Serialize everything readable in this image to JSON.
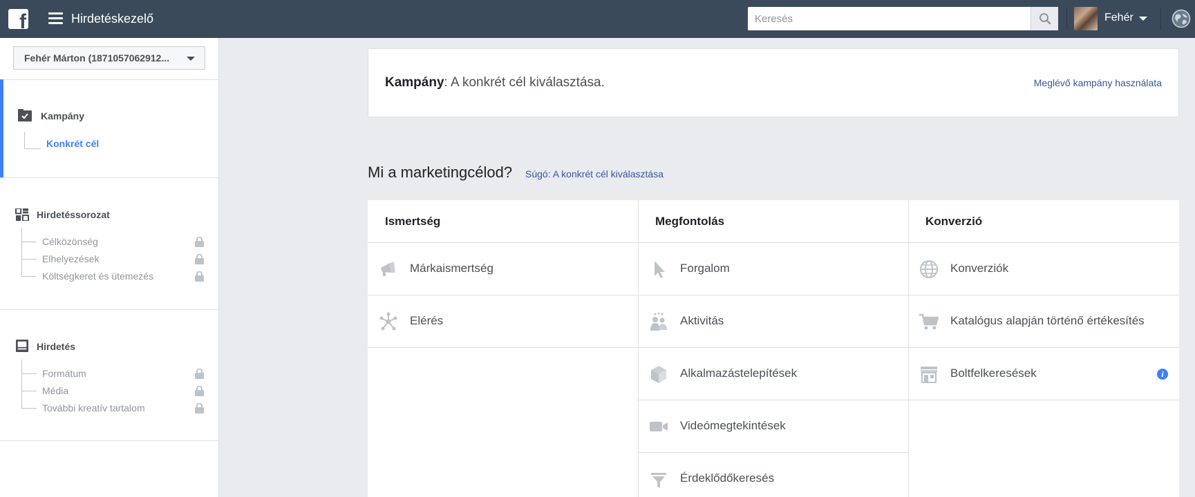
{
  "topbar": {
    "app_title": "Hirdetéskezelő",
    "search_placeholder": "Keresés",
    "user_name": "Fehér",
    "logo_letter": "f",
    "icons": [
      "facebook-logo-icon",
      "hamburger-menu-icon",
      "search-icon",
      "chevron-down-icon",
      "globe-icon"
    ]
  },
  "sidebar": {
    "account_label": "Fehér Márton (1871057062912...",
    "campaign": {
      "title": "Kampány",
      "active_item": "Konkrét cél"
    },
    "adset": {
      "title": "Hirdetéssorozat",
      "items": [
        "Célközönség",
        "Elhelyezések",
        "Költségkeret és ütemezés"
      ]
    },
    "ad": {
      "title": "Hirdetés",
      "items": [
        "Formátum",
        "Média",
        "További kreatív tartalom"
      ]
    }
  },
  "campaign_card": {
    "title_bold": "Kampány",
    "title_rest": ": A konkrét cél kiválasztása.",
    "existing_link": "Meglévő kampány használata"
  },
  "objectives": {
    "question": "Mi a marketingcélod?",
    "help_link": "Súgó: A konkrét cél kiválasztása",
    "columns": [
      {
        "header": "Ismertség",
        "items": [
          {
            "label": "Márkaismertség",
            "icon": "megaphone-icon"
          },
          {
            "label": "Elérés",
            "icon": "reach-icon"
          }
        ]
      },
      {
        "header": "Megfontolás",
        "items": [
          {
            "label": "Forgalom",
            "icon": "cursor-icon"
          },
          {
            "label": "Aktivitás",
            "icon": "people-icon"
          },
          {
            "label": "Alkalmazástelepítések",
            "icon": "box-icon"
          },
          {
            "label": "Videómegtekintések",
            "icon": "video-camera-icon"
          },
          {
            "label": "Érdeklődőkeresés",
            "icon": "funnel-icon"
          }
        ]
      },
      {
        "header": "Konverzió",
        "items": [
          {
            "label": "Konverziók",
            "icon": "globe-icon"
          },
          {
            "label": "Katalógus alapján történő értékesítés",
            "icon": "shopping-cart-icon"
          },
          {
            "label": "Boltfelkeresések",
            "icon": "store-icon"
          }
        ]
      }
    ]
  },
  "colors": {
    "topbar": "#3b4a5a",
    "accent": "#4080ff",
    "link": "#365899",
    "background": "#e9ebee",
    "icon_gray": "#bec3c9"
  }
}
